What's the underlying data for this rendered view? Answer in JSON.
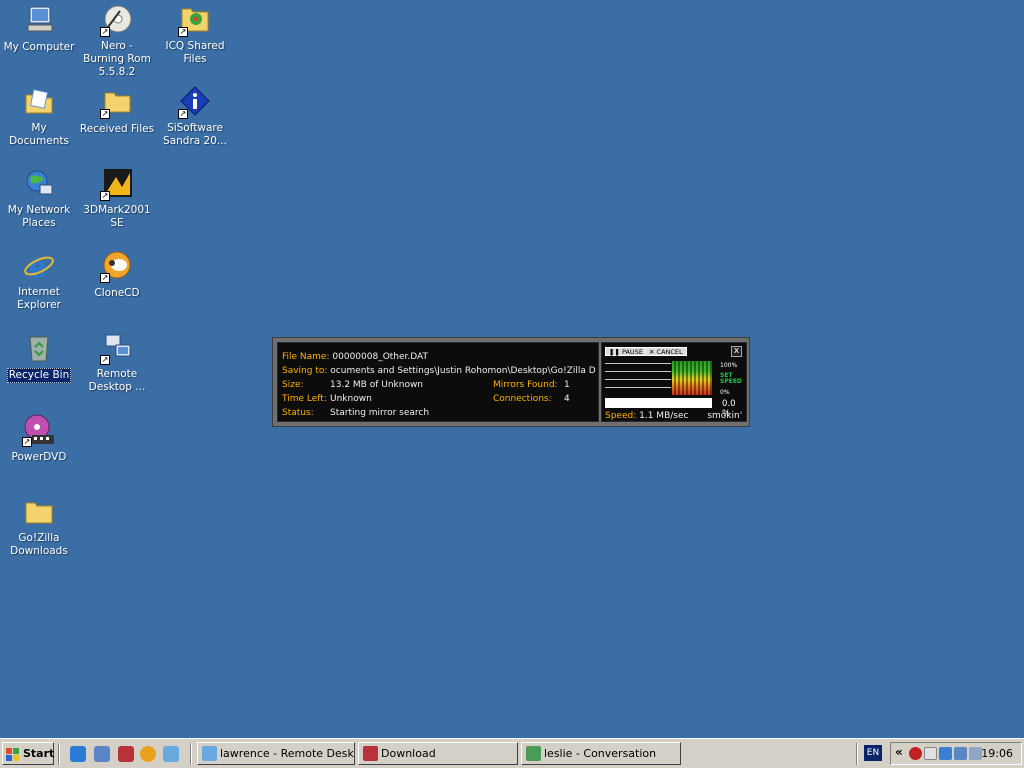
{
  "desktop": {
    "icons": [
      {
        "label": "My Computer"
      },
      {
        "label": "Nero - Burning Rom 5.5.8.2"
      },
      {
        "label": "ICQ Shared Files"
      },
      {
        "label": "My Documents"
      },
      {
        "label": "Received Files"
      },
      {
        "label": "SiSoftware Sandra 20..."
      },
      {
        "label": "My Network Places"
      },
      {
        "label": "3DMark2001 SE"
      },
      {
        "label": "Internet Explorer"
      },
      {
        "label": "CloneCD"
      },
      {
        "label": "Recycle Bin"
      },
      {
        "label": "Remote Desktop ..."
      },
      {
        "label": "PowerDVD"
      },
      {
        "label": "Go!Zilla Downloads"
      }
    ]
  },
  "download": {
    "file_name_label": "File Name:",
    "file_name": "00000008_Other.DAT",
    "saving_to_label": "Saving to:",
    "saving_to": "ocuments and Settings\\Justin Rohomon\\Desktop\\Go!Zilla Dowr",
    "size_label": "Size:",
    "size": "13.2 MB of Unknown",
    "time_left_label": "Time Left:",
    "time_left": "Unknown",
    "status_label": "Status:",
    "status": "Starting mirror search",
    "mirrors_label": "Mirrors Found:",
    "mirrors": "1",
    "connections_label": "Connections:",
    "connections": "4",
    "pause_label": "PAUSE",
    "cancel_label": "CANCEL",
    "close_label": "x",
    "scale_top": "100%",
    "scale_bottom": "0%",
    "set_speed_label": "SET SPEED",
    "percent": "0.0 %",
    "progress_fraction": 0.0,
    "speed_label": "Speed:",
    "speed": "1.1 MB/sec",
    "speed_word": "smokin'"
  },
  "taskbar": {
    "start_label": "Start",
    "tasks": [
      {
        "label": "lawrence - Remote Desktop"
      },
      {
        "label": "Download"
      },
      {
        "label": "leslie - Conversation"
      }
    ],
    "language": "EN",
    "tray_chevron": "«",
    "clock": "19:06"
  }
}
